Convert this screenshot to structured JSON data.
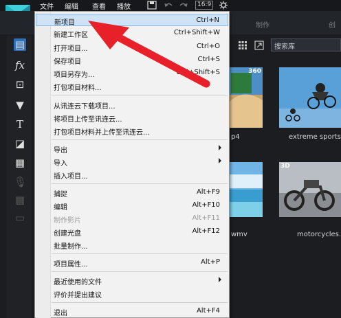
{
  "menubar": {
    "items": [
      "文件",
      "编辑",
      "查看",
      "播放"
    ],
    "ratio": "16:9"
  },
  "tabs": {
    "right_label": "制作",
    "far_label": "创"
  },
  "search": {
    "placeholder": "搜索库"
  },
  "library": {
    "items": [
      {
        "caption": "p4",
        "badge": "360"
      },
      {
        "caption": "extreme sports",
        "badge": ""
      },
      {
        "caption": "wmv",
        "badge": ""
      },
      {
        "caption": "motorcycles.",
        "badge": "3D"
      }
    ]
  },
  "file_menu": {
    "items": [
      {
        "label": "新项目",
        "shortcut": "Ctrl+N"
      },
      {
        "label": "新建工作区",
        "shortcut": "Ctrl+Shift+W"
      },
      {
        "label": "打开项目...",
        "shortcut": "Ctrl+O"
      },
      {
        "label": "保存项目",
        "shortcut": "Ctrl+S"
      },
      {
        "label": "项目另存为...",
        "shortcut": "Ctrl+Shift+S"
      },
      {
        "label": "打包项目材料...",
        "shortcut": ""
      },
      {
        "label": "从讯连云下载项目...",
        "shortcut": ""
      },
      {
        "label": "将项目上传至讯连云...",
        "shortcut": ""
      },
      {
        "label": "打包项目材料并上传至讯连云...",
        "shortcut": ""
      },
      {
        "label": "导出",
        "shortcut": ""
      },
      {
        "label": "导入",
        "shortcut": ""
      },
      {
        "label": "插入项目...",
        "shortcut": ""
      },
      {
        "label": "捕捉",
        "shortcut": "Alt+F9"
      },
      {
        "label": "编辑",
        "shortcut": "Alt+F10"
      },
      {
        "label": "制作影片",
        "shortcut": "Alt+F11"
      },
      {
        "label": "创建光盘",
        "shortcut": "Alt+F12"
      },
      {
        "label": "批量制作...",
        "shortcut": ""
      },
      {
        "label": "项目属性...",
        "shortcut": "Alt+P"
      },
      {
        "label": "最近使用的文件",
        "shortcut": ""
      },
      {
        "label": "评价并提出建议",
        "shortcut": ""
      },
      {
        "label": "退出",
        "shortcut": "Alt+F4"
      }
    ]
  },
  "colors": {
    "highlight": "#cfe3f7",
    "arrow": "#e8202a",
    "background": "#1b1d21"
  }
}
